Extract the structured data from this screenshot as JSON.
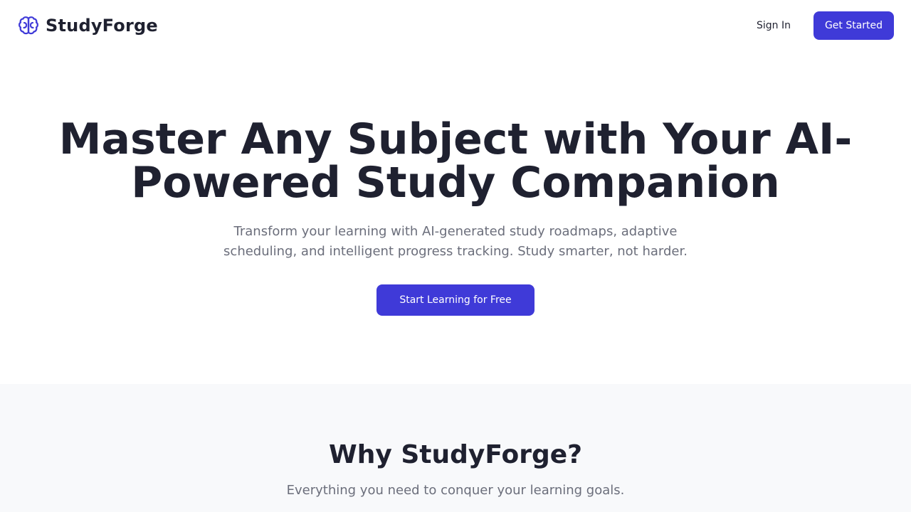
{
  "brand": {
    "name": "StudyForge",
    "icon": "brain-icon",
    "accent_color": "#3f3ad8"
  },
  "nav": {
    "signin_label": "Sign In",
    "get_started_label": "Get Started"
  },
  "hero": {
    "title": "Master Any Subject with Your AI-Powered Study Companion",
    "subtitle": "Transform your learning with AI-generated study roadmaps, adaptive scheduling, and intelligent progress tracking. Study smarter, not harder.",
    "cta_label": "Start Learning for Free"
  },
  "features": {
    "title": "Why StudyForge?",
    "subtitle": "Everything you need to conquer your learning goals.",
    "background_color": "#f8f9fb"
  }
}
